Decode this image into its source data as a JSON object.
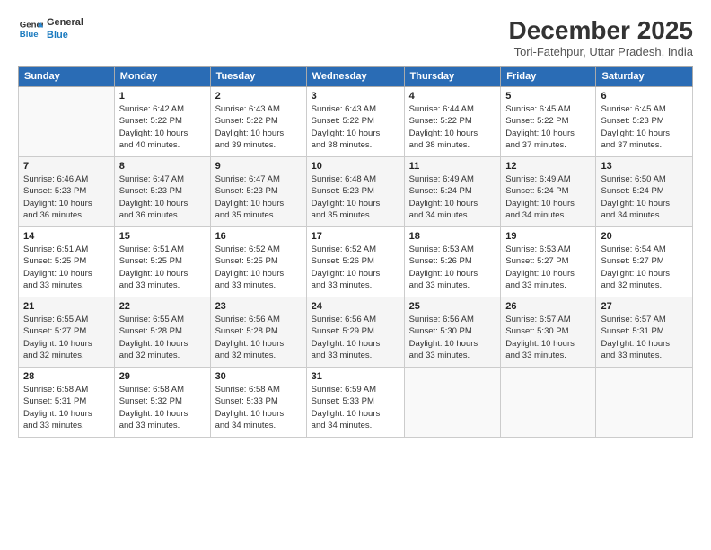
{
  "header": {
    "logo_line1": "General",
    "logo_line2": "Blue",
    "month": "December 2025",
    "location": "Tori-Fatehpur, Uttar Pradesh, India"
  },
  "weekdays": [
    "Sunday",
    "Monday",
    "Tuesday",
    "Wednesday",
    "Thursday",
    "Friday",
    "Saturday"
  ],
  "weeks": [
    [
      {
        "day": "",
        "info": ""
      },
      {
        "day": "1",
        "info": "Sunrise: 6:42 AM\nSunset: 5:22 PM\nDaylight: 10 hours\nand 40 minutes."
      },
      {
        "day": "2",
        "info": "Sunrise: 6:43 AM\nSunset: 5:22 PM\nDaylight: 10 hours\nand 39 minutes."
      },
      {
        "day": "3",
        "info": "Sunrise: 6:43 AM\nSunset: 5:22 PM\nDaylight: 10 hours\nand 38 minutes."
      },
      {
        "day": "4",
        "info": "Sunrise: 6:44 AM\nSunset: 5:22 PM\nDaylight: 10 hours\nand 38 minutes."
      },
      {
        "day": "5",
        "info": "Sunrise: 6:45 AM\nSunset: 5:22 PM\nDaylight: 10 hours\nand 37 minutes."
      },
      {
        "day": "6",
        "info": "Sunrise: 6:45 AM\nSunset: 5:23 PM\nDaylight: 10 hours\nand 37 minutes."
      }
    ],
    [
      {
        "day": "7",
        "info": "Sunrise: 6:46 AM\nSunset: 5:23 PM\nDaylight: 10 hours\nand 36 minutes."
      },
      {
        "day": "8",
        "info": "Sunrise: 6:47 AM\nSunset: 5:23 PM\nDaylight: 10 hours\nand 36 minutes."
      },
      {
        "day": "9",
        "info": "Sunrise: 6:47 AM\nSunset: 5:23 PM\nDaylight: 10 hours\nand 35 minutes."
      },
      {
        "day": "10",
        "info": "Sunrise: 6:48 AM\nSunset: 5:23 PM\nDaylight: 10 hours\nand 35 minutes."
      },
      {
        "day": "11",
        "info": "Sunrise: 6:49 AM\nSunset: 5:24 PM\nDaylight: 10 hours\nand 34 minutes."
      },
      {
        "day": "12",
        "info": "Sunrise: 6:49 AM\nSunset: 5:24 PM\nDaylight: 10 hours\nand 34 minutes."
      },
      {
        "day": "13",
        "info": "Sunrise: 6:50 AM\nSunset: 5:24 PM\nDaylight: 10 hours\nand 34 minutes."
      }
    ],
    [
      {
        "day": "14",
        "info": "Sunrise: 6:51 AM\nSunset: 5:25 PM\nDaylight: 10 hours\nand 33 minutes."
      },
      {
        "day": "15",
        "info": "Sunrise: 6:51 AM\nSunset: 5:25 PM\nDaylight: 10 hours\nand 33 minutes."
      },
      {
        "day": "16",
        "info": "Sunrise: 6:52 AM\nSunset: 5:25 PM\nDaylight: 10 hours\nand 33 minutes."
      },
      {
        "day": "17",
        "info": "Sunrise: 6:52 AM\nSunset: 5:26 PM\nDaylight: 10 hours\nand 33 minutes."
      },
      {
        "day": "18",
        "info": "Sunrise: 6:53 AM\nSunset: 5:26 PM\nDaylight: 10 hours\nand 33 minutes."
      },
      {
        "day": "19",
        "info": "Sunrise: 6:53 AM\nSunset: 5:27 PM\nDaylight: 10 hours\nand 33 minutes."
      },
      {
        "day": "20",
        "info": "Sunrise: 6:54 AM\nSunset: 5:27 PM\nDaylight: 10 hours\nand 32 minutes."
      }
    ],
    [
      {
        "day": "21",
        "info": "Sunrise: 6:55 AM\nSunset: 5:27 PM\nDaylight: 10 hours\nand 32 minutes."
      },
      {
        "day": "22",
        "info": "Sunrise: 6:55 AM\nSunset: 5:28 PM\nDaylight: 10 hours\nand 32 minutes."
      },
      {
        "day": "23",
        "info": "Sunrise: 6:56 AM\nSunset: 5:28 PM\nDaylight: 10 hours\nand 32 minutes."
      },
      {
        "day": "24",
        "info": "Sunrise: 6:56 AM\nSunset: 5:29 PM\nDaylight: 10 hours\nand 33 minutes."
      },
      {
        "day": "25",
        "info": "Sunrise: 6:56 AM\nSunset: 5:30 PM\nDaylight: 10 hours\nand 33 minutes."
      },
      {
        "day": "26",
        "info": "Sunrise: 6:57 AM\nSunset: 5:30 PM\nDaylight: 10 hours\nand 33 minutes."
      },
      {
        "day": "27",
        "info": "Sunrise: 6:57 AM\nSunset: 5:31 PM\nDaylight: 10 hours\nand 33 minutes."
      }
    ],
    [
      {
        "day": "28",
        "info": "Sunrise: 6:58 AM\nSunset: 5:31 PM\nDaylight: 10 hours\nand 33 minutes."
      },
      {
        "day": "29",
        "info": "Sunrise: 6:58 AM\nSunset: 5:32 PM\nDaylight: 10 hours\nand 33 minutes."
      },
      {
        "day": "30",
        "info": "Sunrise: 6:58 AM\nSunset: 5:33 PM\nDaylight: 10 hours\nand 34 minutes."
      },
      {
        "day": "31",
        "info": "Sunrise: 6:59 AM\nSunset: 5:33 PM\nDaylight: 10 hours\nand 34 minutes."
      },
      {
        "day": "",
        "info": ""
      },
      {
        "day": "",
        "info": ""
      },
      {
        "day": "",
        "info": ""
      }
    ]
  ]
}
